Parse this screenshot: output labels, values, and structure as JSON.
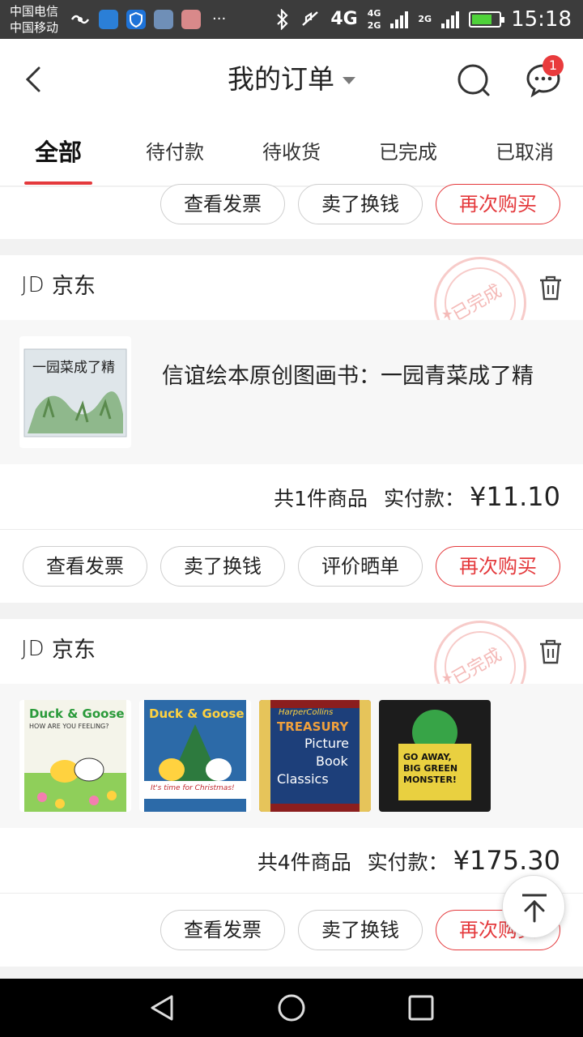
{
  "status_bar": {
    "carrier1": "中国电信",
    "carrier2": "中国移动",
    "dots": "···",
    "net1": "4G",
    "net2": "4G",
    "net3": "2G",
    "net4": "2G",
    "time": "15:18"
  },
  "header": {
    "title": "我的订单",
    "badge_count": "1"
  },
  "tabs": [
    {
      "label": "全部"
    },
    {
      "label": "待付款"
    },
    {
      "label": "待收货"
    },
    {
      "label": "已完成"
    },
    {
      "label": "已取消"
    }
  ],
  "order_top": {
    "buttons": [
      "查看发票",
      "卖了换钱",
      "再次购买"
    ]
  },
  "order1": {
    "logo": "JD",
    "shop": "京东",
    "stamp": "已完成",
    "product_title": "信谊绘本原创图画书：一园青菜成了精",
    "book_cover_text": "一园菜成了精",
    "count_label": "共1件商品",
    "paid_label": "实付款：",
    "price": "¥11.10",
    "buttons": [
      "查看发票",
      "卖了换钱",
      "评价晒单",
      "再次购买"
    ]
  },
  "order2": {
    "logo": "JD",
    "shop": "京东",
    "stamp": "已完成",
    "books": [
      {
        "line1": "Duck & Goose",
        "line2": "HOW ARE YOU FEELING?"
      },
      {
        "line1": "Duck & Goose",
        "line2": "It's time for Christmas!"
      },
      {
        "line1": "HarperCollins",
        "line2": "TREASURY",
        "line3": "Picture",
        "line4": "Book",
        "line5": "Classics"
      },
      {
        "line1": "GO AWAY,",
        "line2": "BIG GREEN",
        "line3": "MONSTER!"
      }
    ],
    "count_label": "共4件商品",
    "paid_label": "实付款：",
    "price": "¥175.30",
    "buttons": [
      "查看发票",
      "卖了换钱",
      "再次购买"
    ]
  },
  "colors": {
    "accent": "#e4393c",
    "stamp": "#f4b7b5"
  }
}
